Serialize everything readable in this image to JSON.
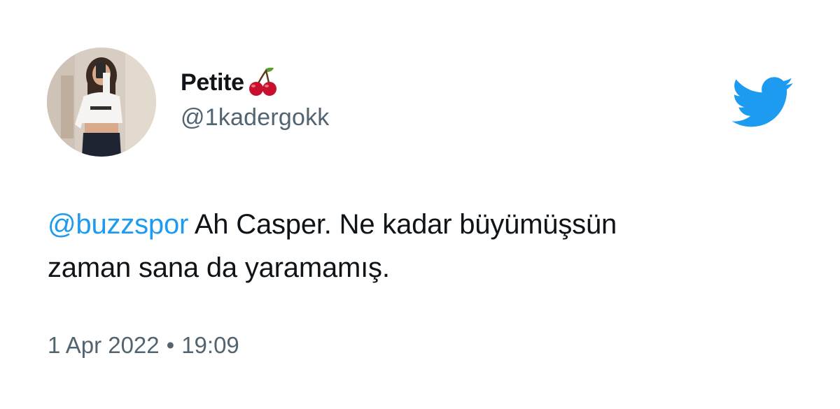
{
  "tweet": {
    "display_name": "Petite",
    "handle": "@1kadergokk",
    "mention": "@buzzspor",
    "text_line1": " Ah Casper. Ne kadar büyümüşsün",
    "text_line2": "zaman sana da yaramamış.",
    "date": "1 Apr 2022",
    "separator": "•",
    "time": "19:09"
  },
  "icons": {
    "name_emoji": "cherry-icon",
    "brand": "twitter-bird-icon"
  },
  "colors": {
    "brand_blue": "#1d9bf0",
    "text_primary": "#0f1419",
    "text_secondary": "#536471"
  }
}
